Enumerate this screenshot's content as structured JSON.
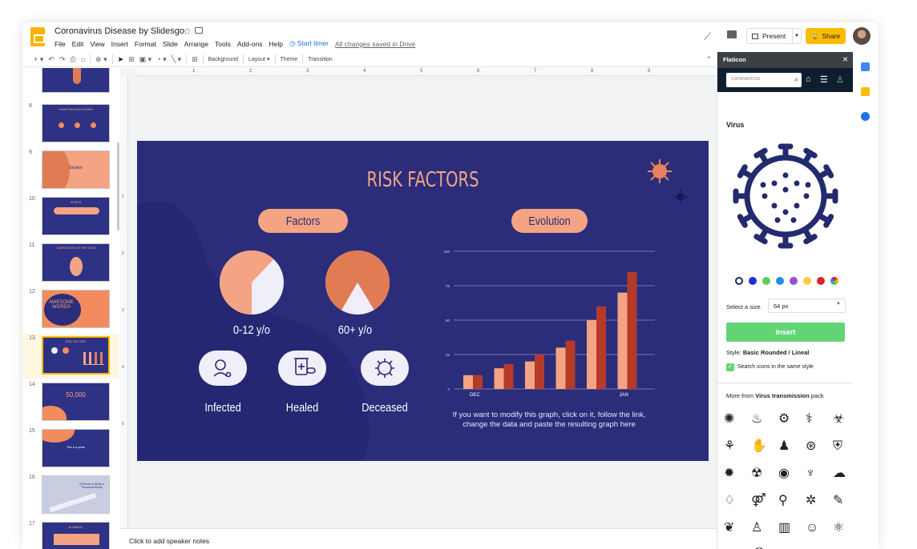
{
  "app": {
    "doc_title": "Coronavirus Disease by Slidesgo",
    "menus": [
      "File",
      "Edit",
      "View",
      "Insert",
      "Format",
      "Slide",
      "Arrange",
      "Tools",
      "Add-ons",
      "Help"
    ],
    "start_timer": "Start timer",
    "saved_status": "All changes saved in Drive",
    "present_label": "Present",
    "share_label": "Share",
    "brand_color": "#f4b400"
  },
  "toolbar": {
    "background_label": "Background",
    "layout_label": "Layout",
    "theme_label": "Theme",
    "transition_label": "Transition"
  },
  "filmstrip": {
    "slides": [
      {
        "num": "8",
        "title": "SYMPTOMS AND STAGES"
      },
      {
        "num": "9",
        "title": "Section"
      },
      {
        "num": "10",
        "title": "WORDS"
      },
      {
        "num": "11",
        "title": "COMPOSITION OF THE VIRUS"
      },
      {
        "num": "12",
        "title": "AWESOME WORDS"
      },
      {
        "num": "13",
        "title": "RISK FACTORS"
      },
      {
        "num": "14",
        "title": "50,000"
      },
      {
        "num": "15",
        "title": "This is a quote"
      },
      {
        "num": "16",
        "title": "A Picture Is Worth a Thousand Words"
      },
      {
        "num": "17",
        "title": "NUMBERS"
      }
    ],
    "selected": "13"
  },
  "ruler": {
    "marks": [
      "1",
      "2",
      "3",
      "4",
      "5",
      "6",
      "7",
      "8",
      "9"
    ],
    "v_marks": [
      "1",
      "2",
      "3",
      "4",
      "5"
    ]
  },
  "slide": {
    "title": "RISK FACTORS",
    "factors_label": "Factors",
    "evolution_label": "Evolution",
    "pie1_label": "0-12 y/o",
    "pie2_label": "60+ y/o",
    "infected_label": "Infected",
    "healed_label": "Healed",
    "deceased_label": "Deceased",
    "chart_note": "If you want to modify this graph, click on it, follow the link, change the data and paste the resulting graph here",
    "bg_color": "#2b2d7a",
    "accent_color": "#f4a482"
  },
  "chart_data": {
    "type": "bar",
    "x_labels_shown": [
      "DEC",
      "JAN"
    ],
    "yticks": [
      "0",
      "25",
      "50",
      "75",
      "100"
    ],
    "ylim": [
      0,
      100
    ],
    "series": [
      {
        "values": [
          10,
          15,
          20,
          30,
          50,
          70
        ]
      },
      {
        "values": [
          10,
          18,
          25,
          35,
          60,
          85
        ]
      }
    ],
    "colors": [
      "#f4a482",
      "#b53a2a"
    ]
  },
  "pies": [
    {
      "fraction": 0.62,
      "color": "#f4a482",
      "rest": "#f0eef8"
    },
    {
      "fraction": 0.83,
      "color": "#e07b54",
      "rest": "#f0eef8"
    }
  ],
  "panel": {
    "title": "Flaticon",
    "search_value": "coronavirus",
    "icon_name": "Virus",
    "colors": [
      "#1a2a6c",
      "#1f2fd1",
      "#5ccf5c",
      "#1f8fe8",
      "#9b4fd6",
      "#f4d03f",
      "#d9262b",
      "#e0913a"
    ],
    "size_label": "Select a size.",
    "size_value": "64 px",
    "insert_label": "Insert",
    "style_prefix": "Style:",
    "style_value": "Basic Rounded / Lineal",
    "search_same_style": "Search icons in the same style",
    "more_from_prefix": "More from",
    "pack_name": "Virus transmission",
    "pack_suffix": "pack"
  },
  "notes": {
    "placeholder": "Click to add speaker notes"
  }
}
